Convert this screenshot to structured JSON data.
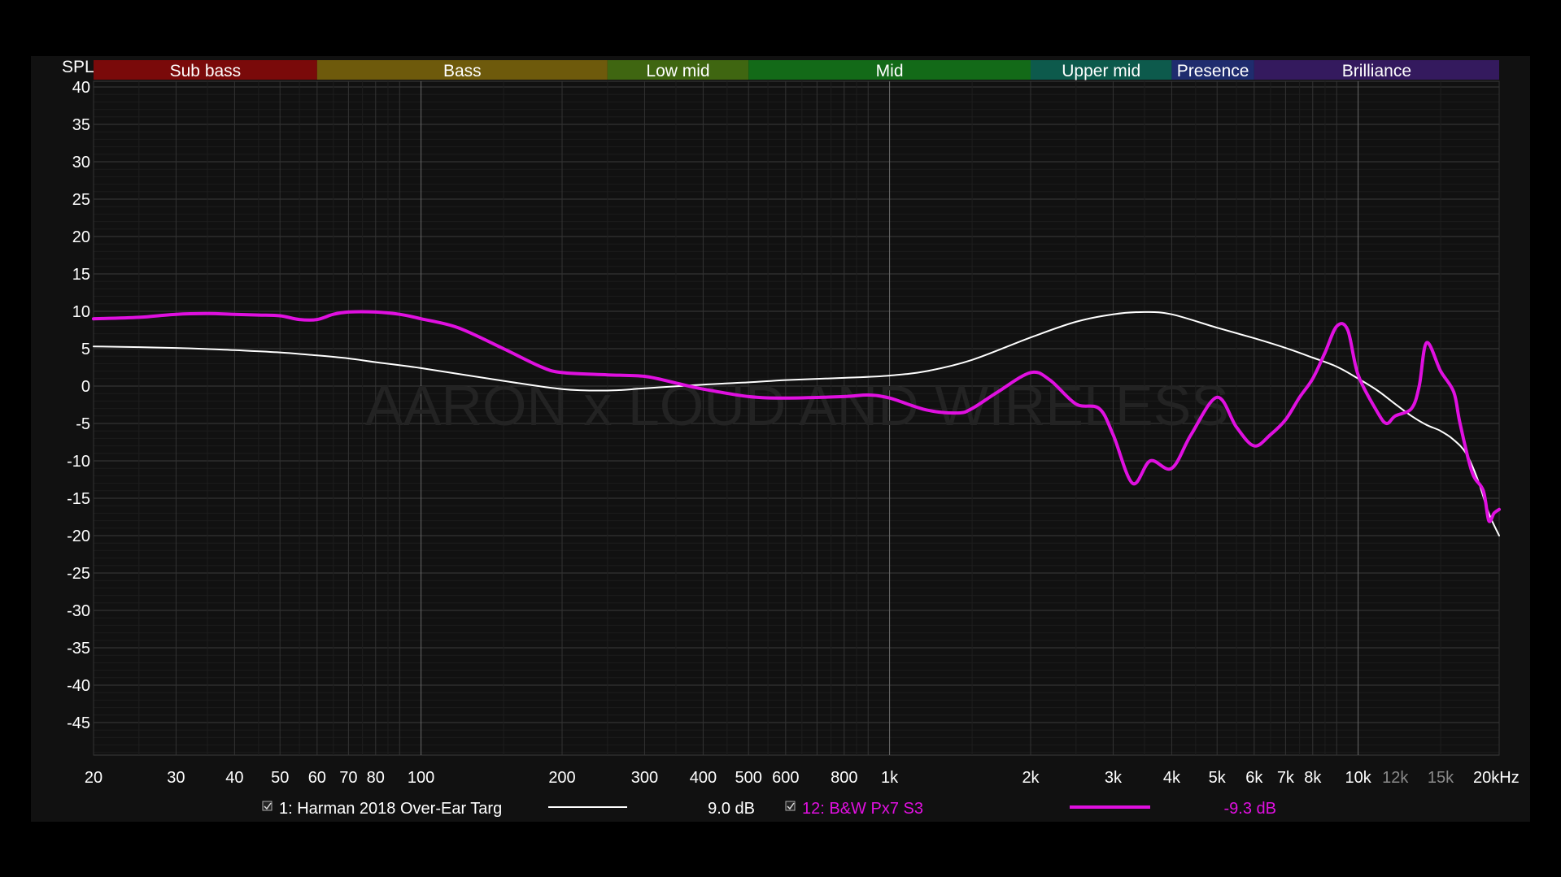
{
  "chart_data": {
    "type": "line",
    "y_axis_label": "SPL",
    "x_unit": "kHz",
    "x_scale": "log",
    "xlim": [
      20,
      20000
    ],
    "ylim": [
      -50,
      40
    ],
    "y_ticks": [
      40,
      35,
      30,
      25,
      20,
      15,
      10,
      5,
      0,
      -5,
      -10,
      -15,
      -20,
      -25,
      -30,
      -35,
      -40,
      -45
    ],
    "x_ticks": [
      {
        "value": 20,
        "label": "20",
        "muted": false
      },
      {
        "value": 30,
        "label": "30",
        "muted": false
      },
      {
        "value": 40,
        "label": "40",
        "muted": false
      },
      {
        "value": 50,
        "label": "50",
        "muted": false
      },
      {
        "value": 60,
        "label": "60",
        "muted": false
      },
      {
        "value": 70,
        "label": "70",
        "muted": false
      },
      {
        "value": 80,
        "label": "80",
        "muted": false
      },
      {
        "value": 100,
        "label": "100",
        "muted": false
      },
      {
        "value": 200,
        "label": "200",
        "muted": false
      },
      {
        "value": 300,
        "label": "300",
        "muted": false
      },
      {
        "value": 400,
        "label": "400",
        "muted": false
      },
      {
        "value": 500,
        "label": "500",
        "muted": false
      },
      {
        "value": 600,
        "label": "600",
        "muted": false
      },
      {
        "value": 800,
        "label": "800",
        "muted": false
      },
      {
        "value": 1000,
        "label": "1k",
        "muted": false
      },
      {
        "value": 2000,
        "label": "2k",
        "muted": false
      },
      {
        "value": 3000,
        "label": "3k",
        "muted": false
      },
      {
        "value": 4000,
        "label": "4k",
        "muted": false
      },
      {
        "value": 5000,
        "label": "5k",
        "muted": false
      },
      {
        "value": 6000,
        "label": "6k",
        "muted": false
      },
      {
        "value": 7000,
        "label": "7k",
        "muted": false
      },
      {
        "value": 8000,
        "label": "8k",
        "muted": false
      },
      {
        "value": 10000,
        "label": "10k",
        "muted": false
      },
      {
        "value": 12000,
        "label": "12k",
        "muted": true
      },
      {
        "value": 15000,
        "label": "15k",
        "muted": true
      },
      {
        "value": 20000,
        "label": "20kHz",
        "muted": false
      }
    ],
    "bands": [
      {
        "name": "Sub bass",
        "from": 20,
        "to": 60,
        "color": "#7a0a0a"
      },
      {
        "name": "Bass",
        "from": 60,
        "to": 250,
        "color": "#6e5a0c"
      },
      {
        "name": "Low mid",
        "from": 250,
        "to": 500,
        "color": "#3f6611"
      },
      {
        "name": "Mid",
        "from": 500,
        "to": 2000,
        "color": "#136a18"
      },
      {
        "name": "Upper mid",
        "from": 2000,
        "to": 4000,
        "color": "#0d5a4c"
      },
      {
        "name": "Presence",
        "from": 4000,
        "to": 6000,
        "color": "#1f2c6e"
      },
      {
        "name": "Brilliance",
        "from": 6000,
        "to": 20000,
        "color": "#341a5e"
      }
    ],
    "watermark": "AARON x LOUD AND WIRELESS",
    "series": [
      {
        "name": "1: Harman 2018 Over-Ear Targ",
        "offset": "9.0 dB",
        "color": "#ffffff",
        "checked": true,
        "points": [
          [
            20,
            5.3
          ],
          [
            30,
            5.1
          ],
          [
            40,
            4.8
          ],
          [
            50,
            4.5
          ],
          [
            60,
            4.1
          ],
          [
            70,
            3.7
          ],
          [
            80,
            3.2
          ],
          [
            100,
            2.4
          ],
          [
            150,
            0.7
          ],
          [
            200,
            -0.4
          ],
          [
            250,
            -0.6
          ],
          [
            300,
            -0.3
          ],
          [
            400,
            0.2
          ],
          [
            500,
            0.5
          ],
          [
            600,
            0.8
          ],
          [
            800,
            1.1
          ],
          [
            1000,
            1.4
          ],
          [
            1200,
            2.0
          ],
          [
            1500,
            3.5
          ],
          [
            2000,
            6.5
          ],
          [
            2500,
            8.6
          ],
          [
            3000,
            9.6
          ],
          [
            3500,
            9.9
          ],
          [
            4000,
            9.6
          ],
          [
            5000,
            7.8
          ],
          [
            6000,
            6.4
          ],
          [
            7000,
            5.1
          ],
          [
            8000,
            3.8
          ],
          [
            9000,
            2.6
          ],
          [
            10000,
            1.0
          ],
          [
            11000,
            -0.6
          ],
          [
            12000,
            -2.4
          ],
          [
            13000,
            -4.0
          ],
          [
            14000,
            -5.2
          ],
          [
            15000,
            -6.0
          ],
          [
            16000,
            -7.2
          ],
          [
            17000,
            -9.0
          ],
          [
            18000,
            -12.5
          ],
          [
            19000,
            -17.0
          ],
          [
            20000,
            -20.0
          ]
        ]
      },
      {
        "name": "12: B&W Px7 S3",
        "offset": "-9.3 dB",
        "color": "#e010e0",
        "checked": true,
        "points": [
          [
            20,
            9.0
          ],
          [
            25,
            9.2
          ],
          [
            30,
            9.6
          ],
          [
            35,
            9.7
          ],
          [
            40,
            9.6
          ],
          [
            45,
            9.5
          ],
          [
            50,
            9.4
          ],
          [
            55,
            8.9
          ],
          [
            60,
            8.9
          ],
          [
            65,
            9.6
          ],
          [
            70,
            9.9
          ],
          [
            80,
            9.9
          ],
          [
            90,
            9.6
          ],
          [
            100,
            9.0
          ],
          [
            120,
            7.8
          ],
          [
            150,
            5.0
          ],
          [
            180,
            2.6
          ],
          [
            200,
            1.8
          ],
          [
            250,
            1.5
          ],
          [
            300,
            1.3
          ],
          [
            350,
            0.4
          ],
          [
            400,
            -0.4
          ],
          [
            500,
            -1.4
          ],
          [
            600,
            -1.6
          ],
          [
            800,
            -1.4
          ],
          [
            900,
            -1.2
          ],
          [
            1000,
            -1.6
          ],
          [
            1200,
            -3.2
          ],
          [
            1400,
            -3.6
          ],
          [
            1500,
            -3.0
          ],
          [
            1700,
            -0.8
          ],
          [
            2000,
            1.8
          ],
          [
            2200,
            0.8
          ],
          [
            2500,
            -2.4
          ],
          [
            2800,
            -3.0
          ],
          [
            3000,
            -6.5
          ],
          [
            3300,
            -13.0
          ],
          [
            3600,
            -10.0
          ],
          [
            4000,
            -11.0
          ],
          [
            4400,
            -6.5
          ],
          [
            5000,
            -1.5
          ],
          [
            5500,
            -5.5
          ],
          [
            6000,
            -8.0
          ],
          [
            6500,
            -6.5
          ],
          [
            7000,
            -4.5
          ],
          [
            7500,
            -1.5
          ],
          [
            8000,
            1.0
          ],
          [
            8500,
            4.5
          ],
          [
            9000,
            8.0
          ],
          [
            9500,
            7.5
          ],
          [
            10000,
            1.5
          ],
          [
            11000,
            -3.5
          ],
          [
            11500,
            -5.0
          ],
          [
            12000,
            -4.0
          ],
          [
            13000,
            -3.0
          ],
          [
            13500,
            0.0
          ],
          [
            14000,
            5.8
          ],
          [
            15000,
            2.0
          ],
          [
            16000,
            -0.8
          ],
          [
            16500,
            -5.0
          ],
          [
            17500,
            -11.5
          ],
          [
            18500,
            -14.0
          ],
          [
            19000,
            -18.0
          ],
          [
            19500,
            -17.0
          ],
          [
            20000,
            -16.5
          ]
        ]
      }
    ]
  }
}
